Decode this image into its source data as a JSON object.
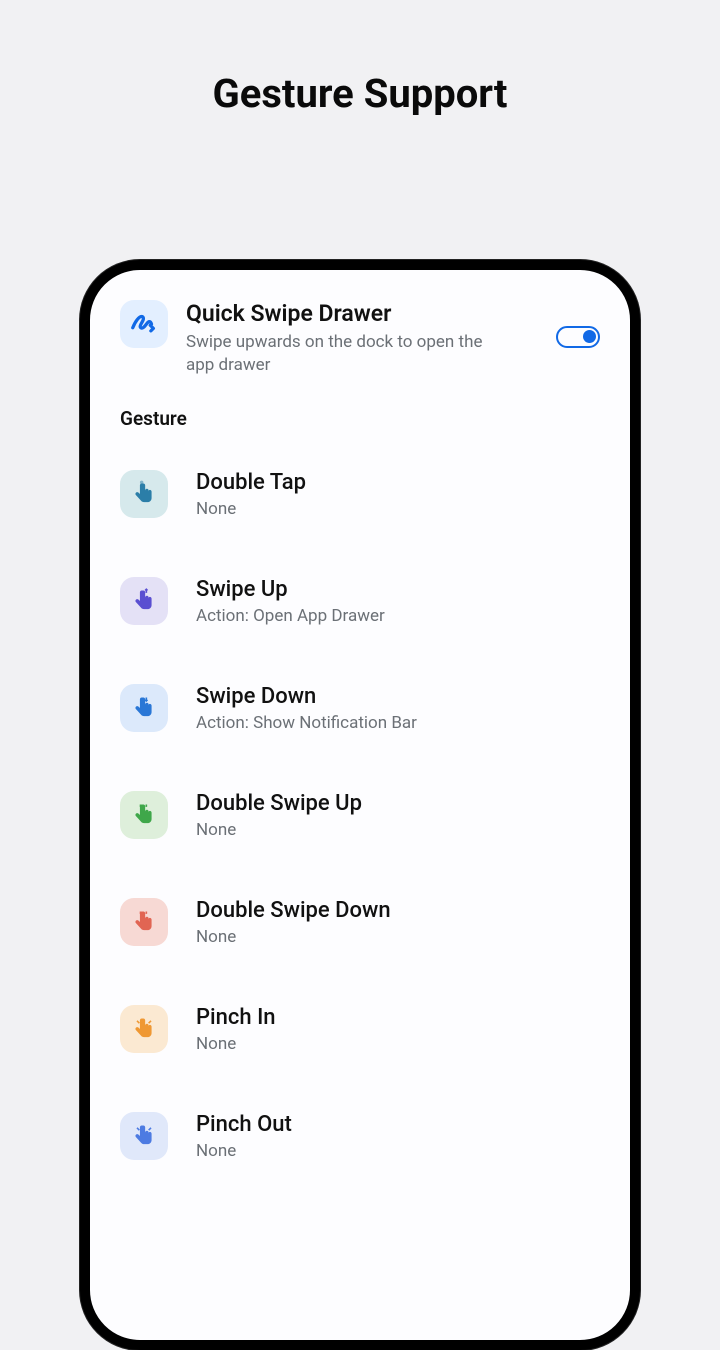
{
  "page_title": "Gesture Support",
  "quick": {
    "title": "Quick Swipe Drawer",
    "subtitle": "Swipe upwards on the dock to open the app drawer"
  },
  "section_label": "Gesture",
  "gestures": [
    {
      "title": "Double Tap",
      "sub": "None",
      "bg": "#d6e9ec",
      "fg": "#2b7ea8"
    },
    {
      "title": "Swipe Up",
      "sub": "Action: Open App Drawer",
      "bg": "#e4e1f6",
      "fg": "#5a4fd1"
    },
    {
      "title": "Swipe Down",
      "sub": "Action: Show Notification Bar",
      "bg": "#dce9fb",
      "fg": "#2a77d6"
    },
    {
      "title": "Double Swipe Up",
      "sub": "None",
      "bg": "#deefdb",
      "fg": "#3fa74a"
    },
    {
      "title": "Double Swipe Down",
      "sub": "None",
      "bg": "#f7d9d4",
      "fg": "#e16553"
    },
    {
      "title": "Pinch In",
      "sub": "None",
      "bg": "#fbe9d2",
      "fg": "#ef9833"
    },
    {
      "title": "Pinch Out",
      "sub": "None",
      "bg": "#e0e8fa",
      "fg": "#4d7be2"
    }
  ]
}
